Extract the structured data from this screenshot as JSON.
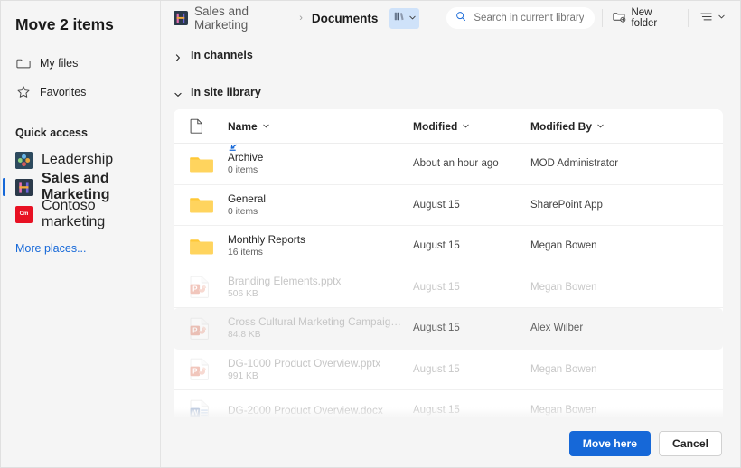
{
  "dialog": {
    "title": "Move 2 items"
  },
  "sidebar": {
    "nav": [
      {
        "label": "My files",
        "icon": "folder-icon"
      },
      {
        "label": "Favorites",
        "icon": "star-icon"
      }
    ],
    "group_title": "Quick access",
    "sites": [
      {
        "label": "Leadership",
        "icon": "leadership-site-icon",
        "selected": false,
        "badge_text": "",
        "badge_color": "#2d4a5e"
      },
      {
        "label": "Sales and Marketing",
        "icon": "sales-marketing-site-icon",
        "selected": true,
        "badge_text": "",
        "badge_color": "#2b3a4a"
      },
      {
        "label": "Contoso marketing",
        "icon": "contoso-site-icon",
        "selected": false,
        "badge_text": "Cm",
        "badge_color": "#e81123"
      }
    ],
    "more_places": "More places..."
  },
  "topbar": {
    "breadcrumb_site": "Sales and Marketing",
    "breadcrumb_sep": "›",
    "breadcrumb_current": "Documents",
    "library_chip_icon": "library-books-icon",
    "search_placeholder": "Search in current library",
    "search_value": "",
    "search_icon": "search-icon",
    "new_folder_label": "New folder",
    "new_folder_icon": "new-folder-icon",
    "view_options_icon": "view-options-icon"
  },
  "sections": [
    {
      "label": "In channels",
      "expanded": false
    },
    {
      "label": "In site library",
      "expanded": true
    }
  ],
  "table": {
    "columns": {
      "icon": "",
      "name": "Name",
      "modified": "Modified",
      "modified_by": "Modified By"
    },
    "rows": [
      {
        "name": "Archive",
        "sub": "0 items",
        "modified": "About an hour ago",
        "modified_by": "MOD Administrator",
        "kind": "folder",
        "disabled": false,
        "hovered": false,
        "drag_indicator": true
      },
      {
        "name": "General",
        "sub": "0 items",
        "modified": "August 15",
        "modified_by": "SharePoint App",
        "kind": "folder",
        "disabled": false,
        "hovered": false,
        "drag_indicator": false
      },
      {
        "name": "Monthly Reports",
        "sub": "16 items",
        "modified": "August 15",
        "modified_by": "Megan Bowen",
        "kind": "folder",
        "disabled": false,
        "hovered": false,
        "drag_indicator": false
      },
      {
        "name": "Branding Elements.pptx",
        "sub": "506 KB",
        "modified": "August 15",
        "modified_by": "Megan Bowen",
        "kind": "pptx",
        "disabled": true,
        "hovered": false,
        "drag_indicator": false
      },
      {
        "name": "Cross Cultural Marketing Campaigns.p...",
        "sub": "84.8 KB",
        "modified": "August 15",
        "modified_by": "Alex Wilber",
        "kind": "pptx",
        "disabled": true,
        "hovered": true,
        "drag_indicator": false
      },
      {
        "name": "DG-1000 Product Overview.pptx",
        "sub": "991 KB",
        "modified": "August 15",
        "modified_by": "Megan Bowen",
        "kind": "pptx",
        "disabled": true,
        "hovered": false,
        "drag_indicator": false
      },
      {
        "name": "DG-2000 Product Overview.docx",
        "sub": "",
        "modified": "August 15",
        "modified_by": "Megan Bowen",
        "kind": "docx",
        "disabled": true,
        "hovered": false,
        "drag_indicator": false
      }
    ]
  },
  "footer": {
    "primary_label": "Move here",
    "secondary_label": "Cancel"
  },
  "colors": {
    "accent": "#1668d8",
    "folder": "#ffd04b",
    "pptx": "#d24726",
    "docx": "#2b579a",
    "chip_bg": "#cfe2f9"
  }
}
